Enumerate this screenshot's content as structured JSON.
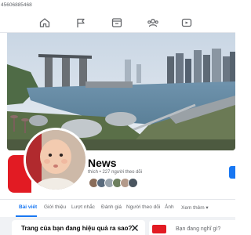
{
  "browser": {
    "url_fragment": "45606885468"
  },
  "navbar": {
    "icons": [
      "home-icon",
      "flag-icon",
      "marketplace-icon",
      "groups-icon",
      "gaming-icon"
    ]
  },
  "profile": {
    "name": "News",
    "stats": "thích • 227 người theo dõi"
  },
  "tabs": [
    {
      "label": "Bài viết",
      "active": true
    },
    {
      "label": "Giới thiệu",
      "active": false
    },
    {
      "label": "Lượt nhắc",
      "active": false
    },
    {
      "label": "Đánh giá",
      "active": false
    },
    {
      "label": "Người theo dõi",
      "active": false
    },
    {
      "label": "Ảnh",
      "active": false
    },
    {
      "label": "Xem thêm ▾",
      "active": false
    }
  ],
  "cards": {
    "left_title": "Trang của bạn đang hiệu quả ra sao?",
    "right_prompt": "Bạn đang nghĩ gì?"
  },
  "colors": {
    "accent": "#1877f2",
    "brand_red": "#e21b23",
    "text_secondary": "#65676b"
  }
}
